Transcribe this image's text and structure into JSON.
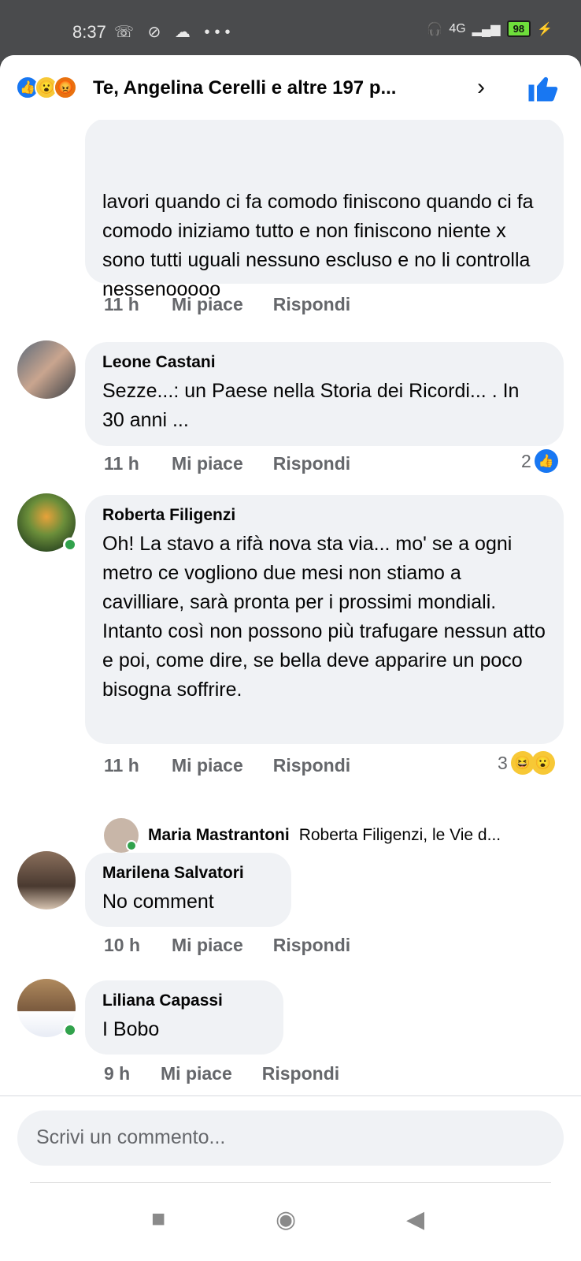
{
  "status_bar": {
    "time": "8:37",
    "left_icons": "☏ ⊘ ☁ •••",
    "network": "4G",
    "battery": "98"
  },
  "header": {
    "title": "Te, Angelina Cerelli e altre 197 p..."
  },
  "comments": [
    {
      "text": "lavori quando ci fa comodo finiscono quando ci fa comodo iniziamo tutto e non finiscono niente x sono tutti uguali nessuno escluso e no li controlla nessenooooo",
      "time": "11 h",
      "like": "Mi piace",
      "reply": "Rispondi"
    },
    {
      "author": "Leone Castani",
      "text": "Sezze...: un Paese  nella Storia dei Ricordi... . In 30 anni ...",
      "time": "11 h",
      "like": "Mi piace",
      "reply": "Rispondi",
      "reaction_count": "2"
    },
    {
      "author": "Roberta Filigenzi",
      "text": "Oh! La stavo a rifà nova sta via... mo' se a ogni metro ce vogliono due mesi non stiamo a cavilliare, sarà pronta per i prossimi mondiali. Intanto così non possono più trafugare nessun atto e poi, come dire, se bella deve apparire un poco bisogna soffrire.",
      "time": "11 h",
      "like": "Mi piace",
      "reply": "Rispondi",
      "reaction_count": "3"
    },
    {
      "author": "Marilena Salvatori",
      "text": "No comment",
      "time": "10 h",
      "like": "Mi piace",
      "reply": "Rispondi"
    },
    {
      "author": "Liliana Capassi",
      "text": "I Bobo",
      "time": "9 h",
      "like": "Mi piace",
      "reply": "Rispondi"
    }
  ],
  "reply_preview": {
    "name": "Maria Mastrantoni",
    "text": "Roberta Filigenzi, le Vie d..."
  },
  "composer": {
    "placeholder": "Scrivi un commento..."
  },
  "colors": {
    "accent": "#1877f2",
    "bubble": "#f0f2f5",
    "meta": "#65676b",
    "online": "#31a24c"
  }
}
